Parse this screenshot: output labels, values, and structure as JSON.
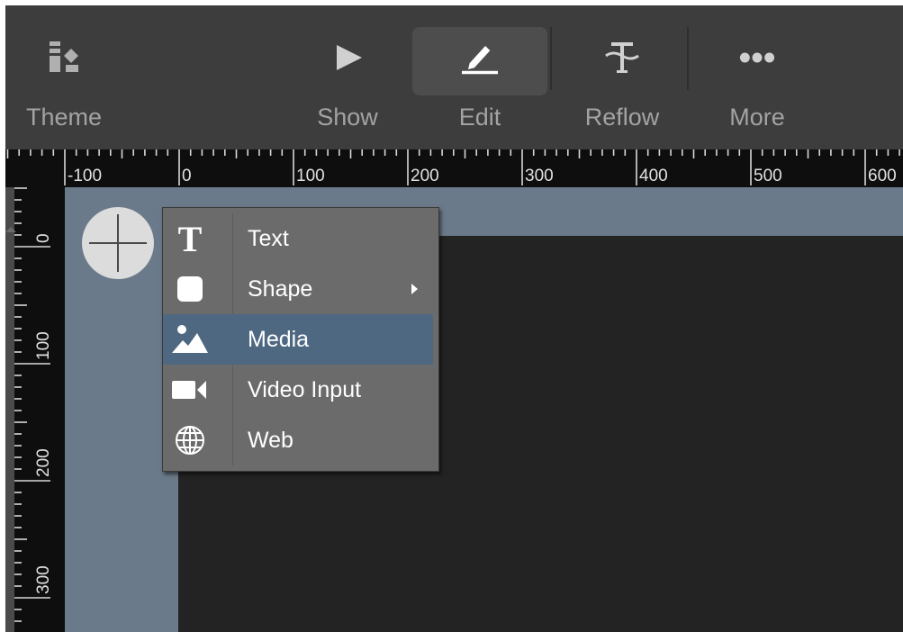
{
  "toolbar": {
    "items": [
      {
        "id": "theme",
        "label": "Theme",
        "icon": "theme-icon"
      },
      {
        "id": "show",
        "label": "Show",
        "icon": "play-icon"
      },
      {
        "id": "edit",
        "label": "Edit",
        "icon": "pencil-icon",
        "active": true
      },
      {
        "id": "reflow",
        "label": "Reflow",
        "icon": "reflow-icon"
      },
      {
        "id": "more",
        "label": "More",
        "icon": "more-dots-icon"
      }
    ]
  },
  "horizontal_ruler": {
    "labels": [
      "-100",
      "0",
      "100",
      "200",
      "300",
      "400",
      "500",
      "600"
    ]
  },
  "vertical_ruler": {
    "labels": [
      "0",
      "100",
      "200",
      "300"
    ]
  },
  "canvas": {
    "add_button_icon": "plus-icon"
  },
  "context_menu": {
    "items": [
      {
        "label": "Text",
        "icon": "text-icon",
        "submenu": false,
        "highlighted": false
      },
      {
        "label": "Shape",
        "icon": "shape-icon",
        "submenu": true,
        "highlighted": false
      },
      {
        "label": "Media",
        "icon": "media-icon",
        "submenu": false,
        "highlighted": true
      },
      {
        "label": "Video Input",
        "icon": "video-camera-icon",
        "submenu": false,
        "highlighted": false
      },
      {
        "label": "Web",
        "icon": "globe-icon",
        "submenu": false,
        "highlighted": false
      }
    ]
  },
  "colors": {
    "toolbar_bg": "#3d3d3d",
    "canvas_bg": "#6a7a8a",
    "slide_bg": "#232323",
    "menu_bg": "#6b6b6b",
    "menu_highlight": "#4e6882"
  }
}
